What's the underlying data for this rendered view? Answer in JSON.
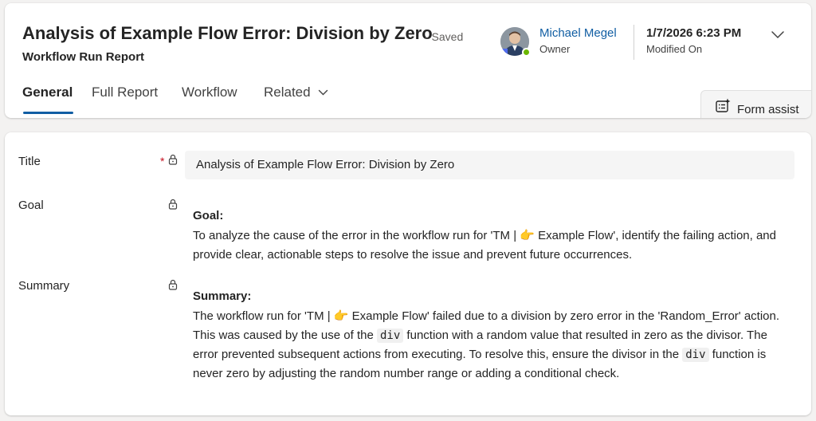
{
  "header": {
    "title": "Analysis of Example Flow Error: Division by Zero",
    "save_status": "- Saved",
    "entity_type": "Workflow Run Report",
    "owner": {
      "name": "Michael Megel",
      "label": "Owner",
      "presence": "available"
    },
    "modified": {
      "value": "1/7/2026 6:23 PM",
      "label": "Modified On"
    },
    "expand_icon": "chevron-down-icon"
  },
  "tabs": [
    {
      "label": "General",
      "active": true
    },
    {
      "label": "Full Report",
      "active": false
    },
    {
      "label": "Workflow",
      "active": false
    },
    {
      "label": "Related",
      "active": false,
      "has_dropdown": true
    }
  ],
  "form_assist": {
    "label": "Form assist",
    "icon": "form-assist-icon"
  },
  "fields": {
    "title": {
      "label": "Title",
      "required_mark": "*",
      "value": "Analysis of Example Flow Error: Division by Zero"
    },
    "goal": {
      "label": "Goal",
      "heading": "Goal:",
      "text_1": "To analyze the cause of the error in the workflow run for 'TM | ",
      "emoji": "👉",
      "text_2": " Example Flow', identify the failing action, and provide clear, actionable steps to resolve the issue and prevent future occurrences."
    },
    "summary": {
      "label": "Summary",
      "heading": "Summary:",
      "text_1": "The workflow run for 'TM | ",
      "emoji": "👉",
      "text_2": " Example Flow' failed due to a division by zero error in the 'Random_Error' action. This was caused by the use of the ",
      "code_1": "div",
      "text_3": " function with a random value that resulted in zero as the divisor. The error prevented subsequent actions from executing. To resolve this, ensure the divisor in the ",
      "code_2": "div",
      "text_4": " function is never zero by adjusting the random number range or adding a conditional check."
    }
  },
  "colors": {
    "accent": "#115ea3",
    "required": "#c50f1f",
    "presence_available": "#6bb700",
    "page_background": "#f3f2f1",
    "input_background": "#f5f5f5"
  }
}
